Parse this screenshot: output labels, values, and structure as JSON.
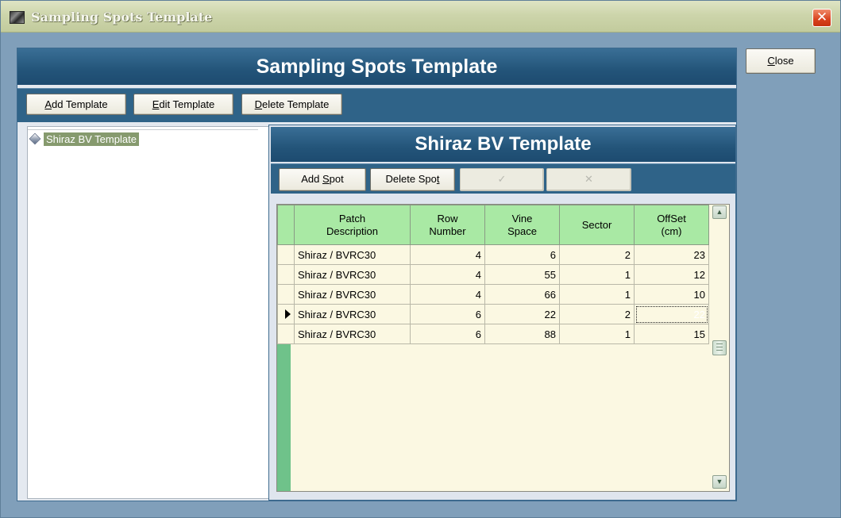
{
  "window": {
    "title": "Sampling Spots Template",
    "close_glyph": "✕"
  },
  "close_button": {
    "label_pre": "",
    "label_u": "C",
    "label_post": "lose"
  },
  "main_header": "Sampling Spots Template",
  "template_toolbar": {
    "add": {
      "u": "A",
      "rest": "dd Template"
    },
    "edit": {
      "u": "E",
      "rest": "dit Template"
    },
    "delete": {
      "u": "D",
      "rest": "elete Template"
    }
  },
  "tree": {
    "items": [
      {
        "label": "Shiraz BV Template",
        "icon": "template-node-icon"
      }
    ]
  },
  "detail_header": "Shiraz BV Template",
  "spot_toolbar": {
    "add": {
      "pre": "Add ",
      "u": "S",
      "post": "pot"
    },
    "delete": {
      "pre": "Delete Spo",
      "u": "t",
      "post": ""
    },
    "confirm_icon": "check-icon",
    "cancel_icon": "cross-icon",
    "confirm_glyph": "✓",
    "cancel_glyph": "✕"
  },
  "grid": {
    "columns": [
      {
        "line1": "Patch",
        "line2": "Description"
      },
      {
        "line1": "Row",
        "line2": "Number"
      },
      {
        "line1": "Vine",
        "line2": "Space"
      },
      {
        "line1": "Sector",
        "line2": ""
      },
      {
        "line1": "OffSet",
        "line2": "(cm)"
      }
    ],
    "rows": [
      {
        "patch": "Shiraz / BVRC30",
        "row": "4",
        "vine": "6",
        "sector": "2",
        "offset": "23"
      },
      {
        "patch": "Shiraz / BVRC30",
        "row": "4",
        "vine": "55",
        "sector": "1",
        "offset": "12"
      },
      {
        "patch": "Shiraz / BVRC30",
        "row": "4",
        "vine": "66",
        "sector": "1",
        "offset": "10"
      },
      {
        "patch": "Shiraz / BVRC30",
        "row": "6",
        "vine": "22",
        "sector": "2",
        "offset": "22"
      },
      {
        "patch": "Shiraz / BVRC30",
        "row": "6",
        "vine": "88",
        "sector": "1",
        "offset": "15"
      }
    ],
    "current_row": 3,
    "scroll_up_glyph": "▲",
    "scroll_down_glyph": "▼"
  },
  "colors": {
    "header_blue": "#235479",
    "grid_header_green": "#a9e9a4",
    "grid_bg": "#fbf8e2",
    "selection_olive": "#839368"
  }
}
